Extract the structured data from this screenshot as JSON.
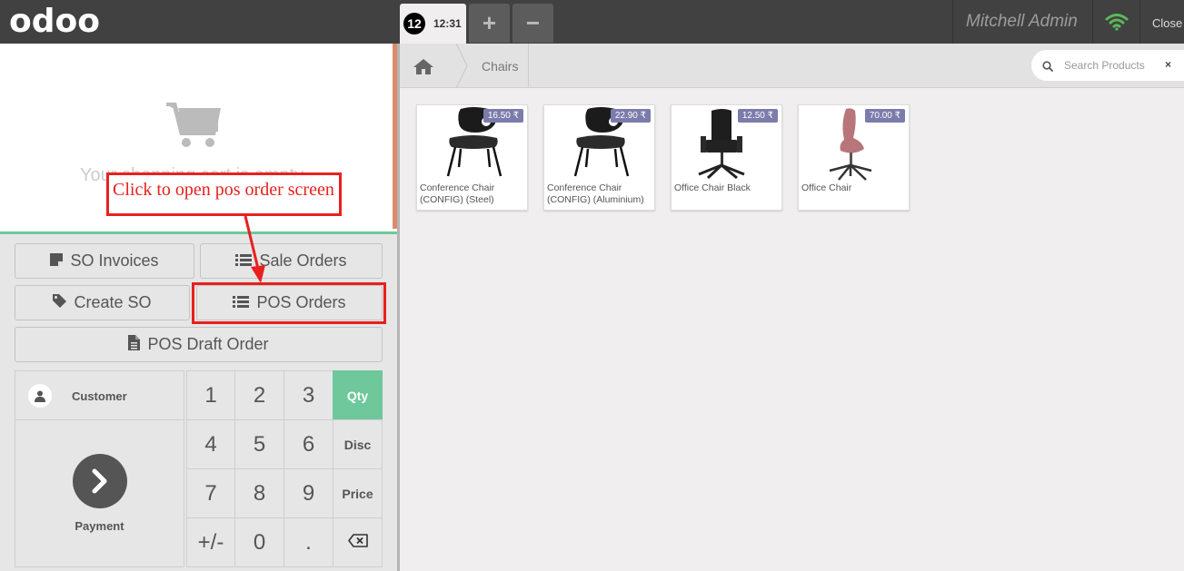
{
  "header": {
    "logo": "odoo",
    "order_number": "12",
    "order_time": "12:31",
    "add_label": "+",
    "remove_label": "−",
    "user": "Mitchell Admin",
    "close_label": "Close"
  },
  "order": {
    "empty_text": "Your shopping cart is empty"
  },
  "control_buttons": {
    "so_invoices": "SO Invoices",
    "sale_orders": "Sale Orders",
    "create_so": "Create SO",
    "pos_orders": "POS Orders",
    "pos_draft_order": "POS Draft Order"
  },
  "actionpad": {
    "customer_label": "Customer",
    "payment_label": "Payment"
  },
  "numpad": {
    "keys": [
      "1",
      "2",
      "3",
      "4",
      "5",
      "6",
      "7",
      "8",
      "9",
      "+/-",
      "0",
      "."
    ],
    "modes": [
      "Qty",
      "Disc",
      "Price"
    ],
    "selected_mode": "Qty"
  },
  "breadcrumb": {
    "category": "Chairs"
  },
  "search": {
    "placeholder": "Search Products",
    "clear": "×"
  },
  "products": [
    {
      "name": "Conference Chair (CONFIG) (Steel)",
      "price": "16.50 ₹"
    },
    {
      "name": "Conference Chair (CONFIG) (Aluminium)",
      "price": "22.90 ₹"
    },
    {
      "name": "Office Chair Black",
      "price": "12.50 ₹"
    },
    {
      "name": "Office Chair",
      "price": "70.00 ₹"
    }
  ],
  "annotation": {
    "text": "Click to open pos order screen"
  },
  "colors": {
    "accent": "#6ec89b",
    "price_tag": "#7b7bac",
    "annotation": "#e8201e",
    "header": "#414141"
  }
}
